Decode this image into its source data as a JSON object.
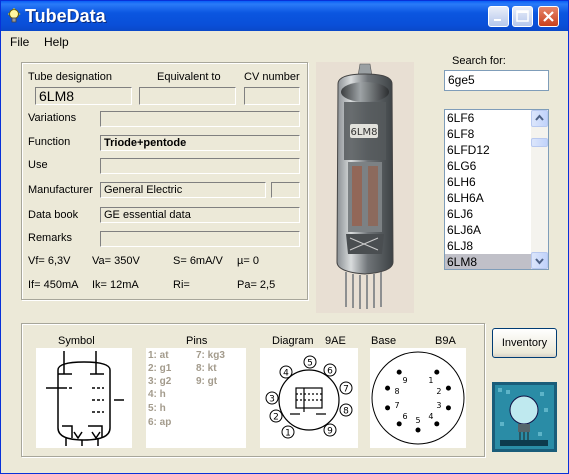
{
  "window": {
    "title": "TubeData"
  },
  "menu": [
    {
      "label": "File"
    },
    {
      "label": "Help"
    }
  ],
  "search": {
    "label": "Search for:",
    "value": "6ge5"
  },
  "tube_list": {
    "items": [
      "6LF6",
      "6LF8",
      "6LFD12",
      "6LG6",
      "6LH6",
      "6LH6A",
      "6LJ6",
      "6LJ6A",
      "6LJ8",
      "6LM8"
    ],
    "selected": "6LM8"
  },
  "details": {
    "tube_designation_label": "Tube designation",
    "equivalent_to_label": "Equivalent to",
    "cv_number_label": "CV number",
    "tube_designation": "6LM8",
    "equivalent_to": "",
    "cv_number": "",
    "variations_label": "Variations",
    "variations": "",
    "function_label": "Function",
    "function": "Triode+pentode",
    "use_label": "Use",
    "use": "",
    "manufacturer_label": "Manufacturer",
    "manufacturer": "General Electric",
    "manufacturer_extra": "",
    "data_book_label": "Data book",
    "data_book": "GE essential data",
    "remarks_label": "Remarks",
    "remarks": ""
  },
  "params": {
    "vf": "Vf= 6,3V",
    "va": "Va= 350V",
    "s": "S= 6mA/V",
    "mu": "µ= 0",
    "if": "If= 450mA",
    "ik": "Ik= 12mA",
    "ri": "Ri=",
    "pa": "Pa= 2,5"
  },
  "bottom": {
    "symbol_label": "Symbol",
    "pins_label": "Pins",
    "diagram_label": "Diagram",
    "diagram_code": "9AE",
    "base_label": "Base",
    "base_code": "B9A",
    "pins_col1": [
      "1: at",
      "2: g1",
      "3: g2",
      "4: h",
      "5: h",
      "6: ap"
    ],
    "pins_col2": [
      "7: kg3",
      "8: kt",
      "9: gt"
    ],
    "diagram_pins": [
      "1",
      "2",
      "3",
      "4",
      "5",
      "6",
      "7",
      "8",
      "9"
    ],
    "base_pins": [
      "1",
      "2",
      "3",
      "4",
      "5",
      "6",
      "7",
      "8",
      "9"
    ]
  },
  "inventory_button": {
    "label": "Inventory"
  },
  "colors": {
    "title_bar": "#0a56e0",
    "window_bg": "#ece9d8",
    "selection": "#c0c0c8"
  }
}
